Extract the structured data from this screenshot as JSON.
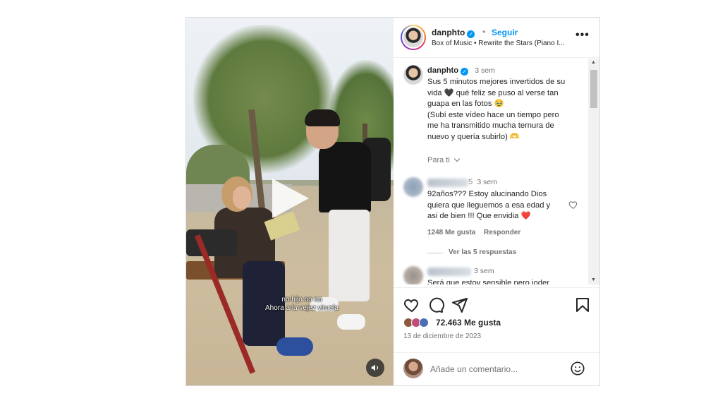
{
  "post": {
    "author": "danphto",
    "follow_label": "Seguir",
    "separator": "•",
    "music": "Box of Music • Rewrite the Stars (Piano I...",
    "more_label": "•••"
  },
  "video": {
    "caption_line1": "no hijo no no",
    "caption_line2": "Ahora a la vejez viruela"
  },
  "caption": {
    "author": "danphto",
    "time": "3 sem",
    "lines": [
      "Sus 5 minutos mejores invertidos de su",
      "vida 🖤 qué feliz se puso al verse tan",
      "guapa en las fotos 🥹",
      "(Subí este vídeo hace un tiempo pero",
      "me ha transmitido mucha ternura de",
      "nuevo y quería subirlo) 🫶"
    ],
    "para_ti": "Para ti"
  },
  "comments": [
    {
      "username_suffix": "5",
      "time": "3 sem",
      "lines": [
        "92años??? Estoy alucinando Dios",
        "quiera que lleguemos a esa edad y",
        "asi de bien !!! Que envidia ❤️"
      ],
      "likes": "1248 Me gusta",
      "reply_label": "Responder",
      "view_replies": "Ver las 5 respuestas"
    },
    {
      "time": "3 sem",
      "lines": [
        "Será que estoy sensible pero joder"
      ]
    }
  ],
  "actions": {
    "likes": "72.463 Me gusta",
    "date": "13 de diciembre de 2023"
  },
  "add_comment": {
    "placeholder": "Añade un comentario..."
  },
  "colors": {
    "accent": "#0095f6",
    "heart_red": "#e0245e",
    "text": "#262626",
    "muted": "#737373"
  },
  "icons": {
    "like": "heart-outline-icon",
    "comment": "comment-icon",
    "share": "paper-plane-icon",
    "save": "bookmark-icon",
    "mute": "speaker-icon",
    "emoji": "smiley-icon",
    "more": "more-options-icon",
    "verified": "verified-badge-icon",
    "dropdown": "chevron-down-icon"
  }
}
